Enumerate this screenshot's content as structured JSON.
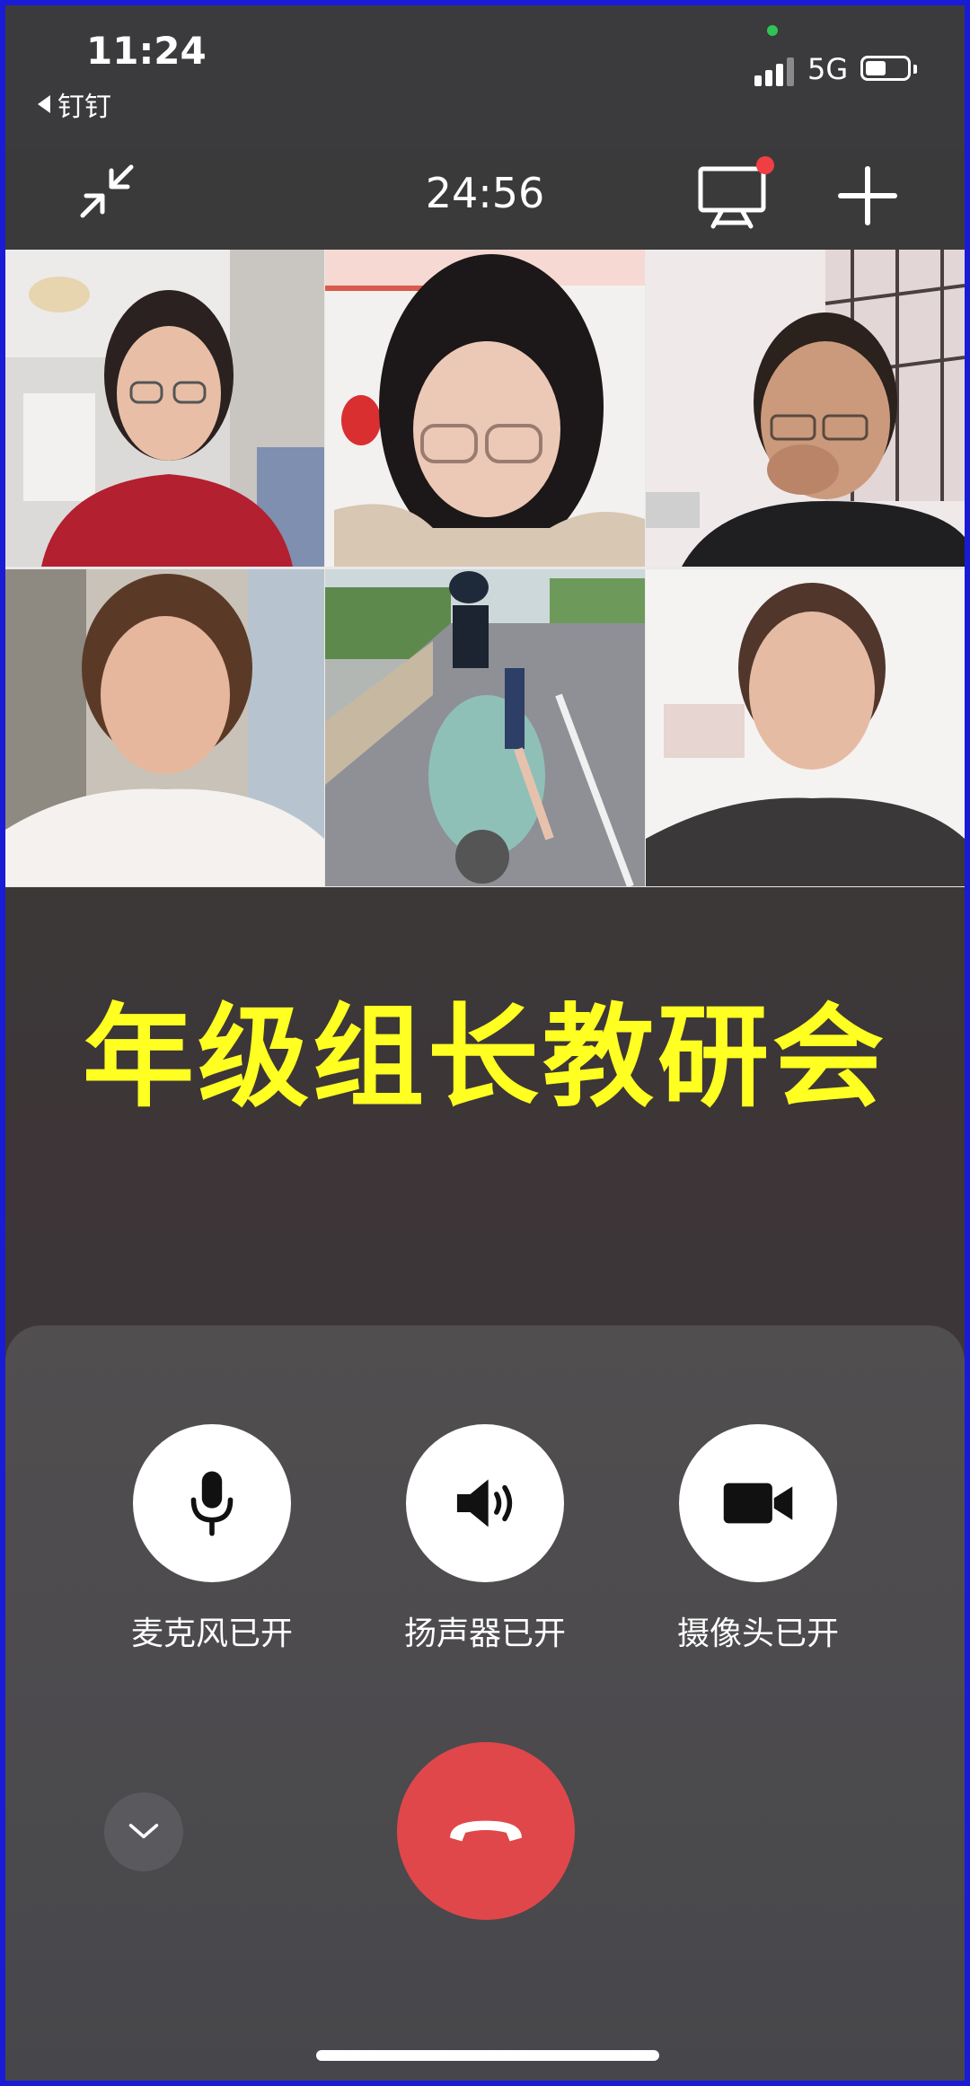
{
  "status_bar": {
    "time": "11:24",
    "back_app": "钉钉",
    "network": "5G",
    "icons": [
      "signal-icon",
      "battery-icon"
    ]
  },
  "call": {
    "timer": "24:56",
    "top_icons": [
      "minimize-icon",
      "screen-share-icon",
      "add-icon"
    ],
    "participants": [
      {
        "tile": "participant-1"
      },
      {
        "tile": "participant-2"
      },
      {
        "tile": "participant-3"
      },
      {
        "tile": "participant-4"
      },
      {
        "tile": "participant-5"
      },
      {
        "tile": "participant-6"
      }
    ],
    "banner": "年级组长教研会"
  },
  "controls": {
    "mic_label": "麦克风已开",
    "speaker_label": "扬声器已开",
    "camera_label": "摄像头已开",
    "icons": [
      "microphone-icon",
      "speaker-icon",
      "camera-icon",
      "chevron-down-icon",
      "hang-up-icon"
    ]
  },
  "colors": {
    "banner": "#ffff22",
    "hangup": "#e0474a",
    "notification_dot": "#ef3f45",
    "border": "#1a1bd4"
  }
}
